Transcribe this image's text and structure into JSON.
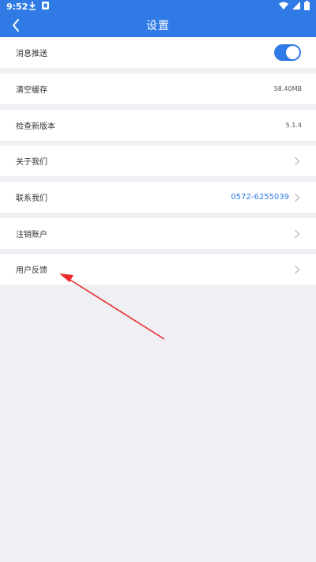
{
  "status": {
    "time": "9:52",
    "icons_left": [
      "download-icon",
      "app-badge-icon"
    ],
    "icons_right": [
      "wifi-icon",
      "signal-icon",
      "battery-icon"
    ]
  },
  "header": {
    "title": "设置",
    "back_icon": "chevron-left-icon",
    "color": "#2f7ae5"
  },
  "settings": {
    "push": {
      "label": "消息推送",
      "enabled": true
    },
    "cache": {
      "label": "清空缓存",
      "value": "58.40MB"
    },
    "version": {
      "label": "检查新版本",
      "value": "5.1.4"
    },
    "about": {
      "label": "关于我们"
    },
    "contact": {
      "label": "联系我们",
      "value": "0572-6255039"
    },
    "logout": {
      "label": "注销账户"
    },
    "feedback": {
      "label": "用户反馈"
    }
  },
  "annotation": {
    "type": "red-arrow",
    "color": "#e82b2b"
  }
}
